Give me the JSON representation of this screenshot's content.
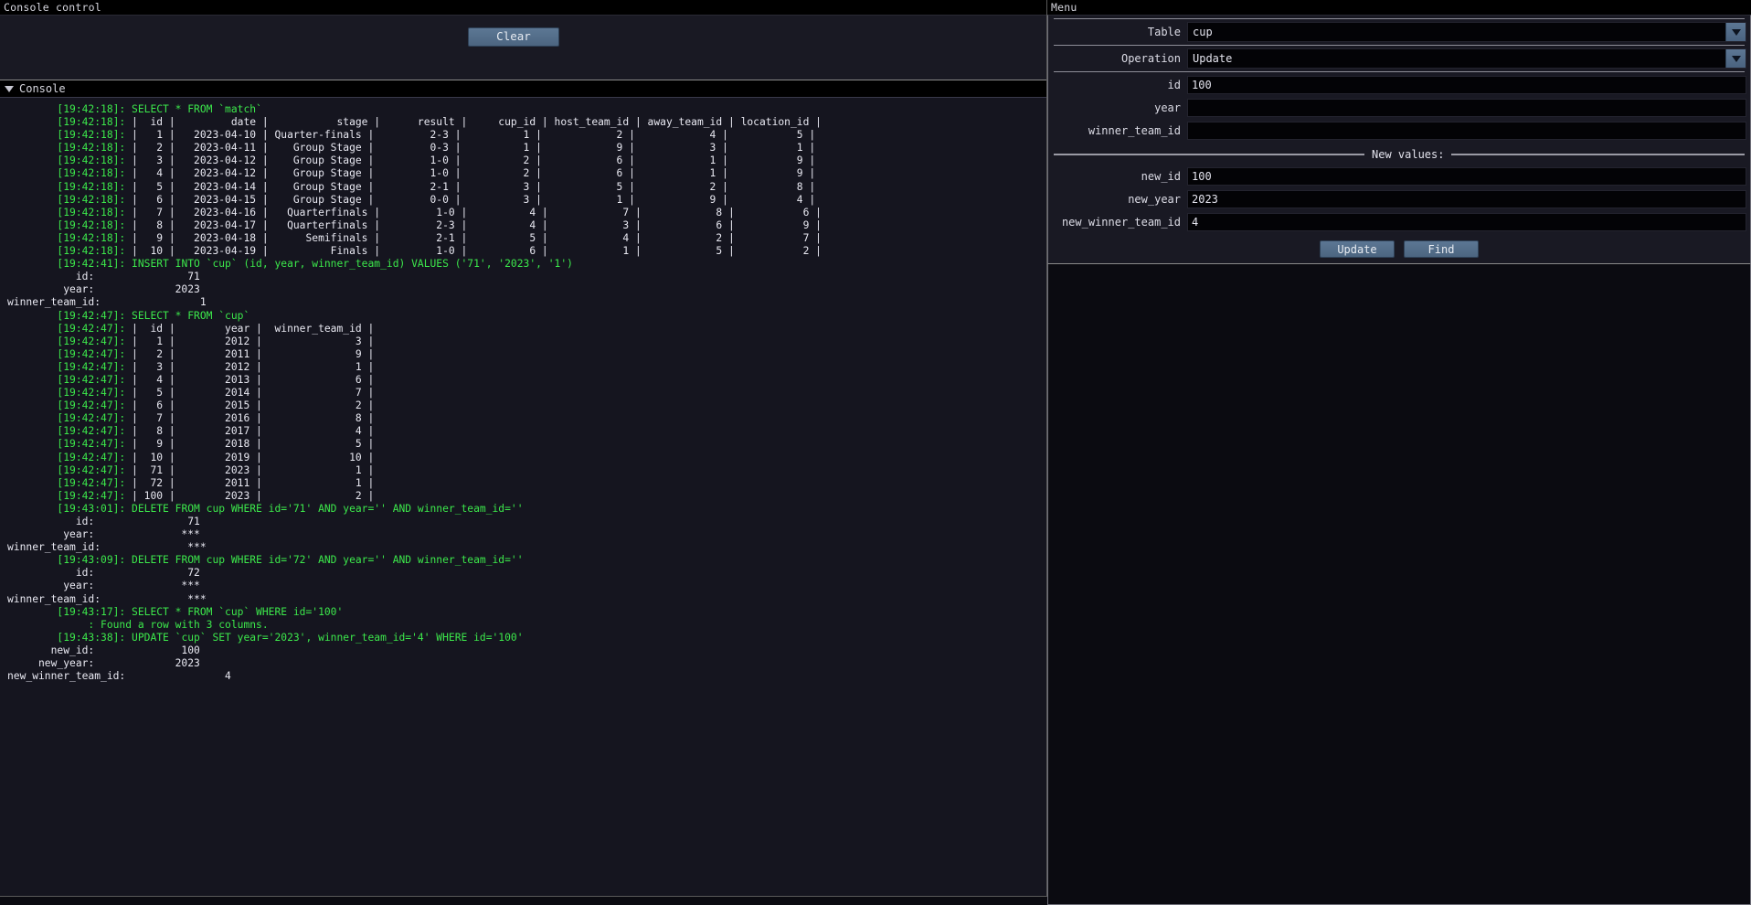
{
  "left_panel": {
    "title": "Console control",
    "toolbar": {
      "clear_label": "Clear"
    },
    "console_section": {
      "header_label": "Console",
      "collapse_icon": "triangle-down-icon"
    }
  },
  "console_log": {
    "lines": [
      {
        "ts": "[19:42:18]:",
        "kind": "query",
        "text": " SELECT * FROM `match`"
      },
      {
        "ts": "[19:42:18]:",
        "kind": "row",
        "text": " |  id |         date |           stage |      result |     cup_id | host_team_id | away_team_id | location_id |"
      },
      {
        "ts": "[19:42:18]:",
        "kind": "row",
        "text": " |   1 |   2023-04-10 | Quarter-finals |         2-3 |          1 |            2 |            4 |           5 |"
      },
      {
        "ts": "[19:42:18]:",
        "kind": "row",
        "text": " |   2 |   2023-04-11 |    Group Stage |         0-3 |          1 |            9 |            3 |           1 |"
      },
      {
        "ts": "[19:42:18]:",
        "kind": "row",
        "text": " |   3 |   2023-04-12 |    Group Stage |         1-0 |          2 |            6 |            1 |           9 |"
      },
      {
        "ts": "[19:42:18]:",
        "kind": "row",
        "text": " |   4 |   2023-04-12 |    Group Stage |         1-0 |          2 |            6 |            1 |           9 |"
      },
      {
        "ts": "[19:42:18]:",
        "kind": "row",
        "text": " |   5 |   2023-04-14 |    Group Stage |         2-1 |          3 |            5 |            2 |           8 |"
      },
      {
        "ts": "[19:42:18]:",
        "kind": "row",
        "text": " |   6 |   2023-04-15 |    Group Stage |         0-0 |          3 |            1 |            9 |           4 |"
      },
      {
        "ts": "[19:42:18]:",
        "kind": "row",
        "text": " |   7 |   2023-04-16 |   Quarterfinals |         1-0 |          4 |            7 |            8 |           6 |"
      },
      {
        "ts": "[19:42:18]:",
        "kind": "row",
        "text": " |   8 |   2023-04-17 |   Quarterfinals |         2-3 |          4 |            3 |            6 |           9 |"
      },
      {
        "ts": "[19:42:18]:",
        "kind": "row",
        "text": " |   9 |   2023-04-18 |      Semifinals |         2-1 |          5 |            4 |            2 |           7 |"
      },
      {
        "ts": "[19:42:18]:",
        "kind": "row",
        "text": " |  10 |   2023-04-19 |          Finals |         1-0 |          6 |            1 |            5 |           2 |"
      },
      {
        "ts": "[19:42:41]:",
        "kind": "query",
        "text": " INSERT INTO `cup` (id, year, winner_team_id) VALUES ('71', '2023', '1')"
      },
      {
        "ts": "",
        "kind": "kv",
        "text": "           id:               71"
      },
      {
        "ts": "",
        "kind": "kv",
        "text": "         year:             2023"
      },
      {
        "ts": "",
        "kind": "kv",
        "text": "winner_team_id:                1"
      },
      {
        "ts": "[19:42:47]:",
        "kind": "query",
        "text": " SELECT * FROM `cup`"
      },
      {
        "ts": "[19:42:47]:",
        "kind": "row",
        "text": " |  id |        year |  winner_team_id |"
      },
      {
        "ts": "[19:42:47]:",
        "kind": "row",
        "text": " |   1 |        2012 |               3 |"
      },
      {
        "ts": "[19:42:47]:",
        "kind": "row",
        "text": " |   2 |        2011 |               9 |"
      },
      {
        "ts": "[19:42:47]:",
        "kind": "row",
        "text": " |   3 |        2012 |               1 |"
      },
      {
        "ts": "[19:42:47]:",
        "kind": "row",
        "text": " |   4 |        2013 |               6 |"
      },
      {
        "ts": "[19:42:47]:",
        "kind": "row",
        "text": " |   5 |        2014 |               7 |"
      },
      {
        "ts": "[19:42:47]:",
        "kind": "row",
        "text": " |   6 |        2015 |               2 |"
      },
      {
        "ts": "[19:42:47]:",
        "kind": "row",
        "text": " |   7 |        2016 |               8 |"
      },
      {
        "ts": "[19:42:47]:",
        "kind": "row",
        "text": " |   8 |        2017 |               4 |"
      },
      {
        "ts": "[19:42:47]:",
        "kind": "row",
        "text": " |   9 |        2018 |               5 |"
      },
      {
        "ts": "[19:42:47]:",
        "kind": "row",
        "text": " |  10 |        2019 |              10 |"
      },
      {
        "ts": "[19:42:47]:",
        "kind": "row",
        "text": " |  71 |        2023 |               1 |"
      },
      {
        "ts": "[19:42:47]:",
        "kind": "row",
        "text": " |  72 |        2011 |               1 |"
      },
      {
        "ts": "[19:42:47]:",
        "kind": "row",
        "text": " | 100 |        2023 |               2 |"
      },
      {
        "ts": "[19:43:01]:",
        "kind": "query",
        "text": " DELETE FROM cup WHERE id='71' AND year='' AND winner_team_id=''"
      },
      {
        "ts": "",
        "kind": "kv",
        "text": "           id:               71"
      },
      {
        "ts": "",
        "kind": "kv",
        "text": "         year:              ***"
      },
      {
        "ts": "",
        "kind": "kv",
        "text": "winner_team_id:              ***"
      },
      {
        "ts": "[19:43:09]:",
        "kind": "query",
        "text": " DELETE FROM cup WHERE id='72' AND year='' AND winner_team_id=''"
      },
      {
        "ts": "",
        "kind": "kv",
        "text": "           id:               72"
      },
      {
        "ts": "",
        "kind": "kv",
        "text": "         year:              ***"
      },
      {
        "ts": "",
        "kind": "kv",
        "text": "winner_team_id:              ***"
      },
      {
        "ts": "[19:43:17]:",
        "kind": "query",
        "text": " SELECT * FROM `cup` WHERE id='100'"
      },
      {
        "ts": "",
        "kind": "note",
        "text": "             : Found a row with 3 columns."
      },
      {
        "ts": "[19:43:38]:",
        "kind": "query",
        "text": " UPDATE `cup` SET year='2023', winner_team_id='4' WHERE id='100'"
      },
      {
        "ts": "",
        "kind": "kv",
        "text": "       new_id:              100"
      },
      {
        "ts": "",
        "kind": "kv",
        "text": "     new_year:             2023"
      },
      {
        "ts": "",
        "kind": "kv",
        "text": "new_winner_team_id:                4"
      }
    ]
  },
  "console_tables": {
    "match": {
      "columns": [
        "id",
        "date",
        "stage",
        "result",
        "cup_id",
        "host_team_id",
        "away_team_id",
        "location_id"
      ],
      "rows": [
        [
          "1",
          "2023-04-10",
          "Quarter-finals",
          "2-3",
          "1",
          "2",
          "4",
          "5"
        ],
        [
          "2",
          "2023-04-11",
          "Group Stage",
          "0-3",
          "1",
          "9",
          "3",
          "1"
        ],
        [
          "3",
          "2023-04-12",
          "Group Stage",
          "1-0",
          "2",
          "6",
          "1",
          "9"
        ],
        [
          "4",
          "2023-04-12",
          "Group Stage",
          "1-0",
          "2",
          "6",
          "1",
          "9"
        ],
        [
          "5",
          "2023-04-14",
          "Group Stage",
          "2-1",
          "3",
          "5",
          "2",
          "8"
        ],
        [
          "6",
          "2023-04-15",
          "Group Stage",
          "0-0",
          "3",
          "1",
          "9",
          "4"
        ],
        [
          "7",
          "2023-04-16",
          "Quarterfinals",
          "1-0",
          "4",
          "7",
          "8",
          "6"
        ],
        [
          "8",
          "2023-04-17",
          "Quarterfinals",
          "2-3",
          "4",
          "3",
          "6",
          "9"
        ],
        [
          "9",
          "2023-04-18",
          "Semifinals",
          "2-1",
          "5",
          "4",
          "2",
          "7"
        ],
        [
          "10",
          "2023-04-19",
          "Finals",
          "1-0",
          "6",
          "1",
          "5",
          "2"
        ]
      ]
    },
    "cup": {
      "columns": [
        "id",
        "year",
        "winner_team_id"
      ],
      "rows": [
        [
          "1",
          "2012",
          "3"
        ],
        [
          "2",
          "2011",
          "9"
        ],
        [
          "3",
          "2012",
          "1"
        ],
        [
          "4",
          "2013",
          "6"
        ],
        [
          "5",
          "2014",
          "7"
        ],
        [
          "6",
          "2015",
          "2"
        ],
        [
          "7",
          "2016",
          "8"
        ],
        [
          "8",
          "2017",
          "4"
        ],
        [
          "9",
          "2018",
          "5"
        ],
        [
          "10",
          "2019",
          "10"
        ],
        [
          "71",
          "2023",
          "1"
        ],
        [
          "72",
          "2011",
          "1"
        ],
        [
          "100",
          "2023",
          "2"
        ]
      ]
    }
  },
  "menu": {
    "title": "Menu",
    "table_label": "Table",
    "table_value": "cup",
    "operation_label": "Operation",
    "operation_value": "Update",
    "fields": [
      {
        "label": "id",
        "value": "100",
        "placeholder": ""
      },
      {
        "label": "year",
        "value": "",
        "placeholder": ""
      },
      {
        "label": "winner_team_id",
        "value": "",
        "placeholder": ""
      }
    ],
    "new_values_label": "New values:",
    "new_fields": [
      {
        "label": "new_id",
        "value": "100",
        "placeholder": ""
      },
      {
        "label": "new_year",
        "value": "2023",
        "placeholder": ""
      },
      {
        "label": "new_winner_team_id",
        "value": "4",
        "placeholder": ""
      }
    ],
    "update_label": "Update",
    "find_label": "Find",
    "dropdown_icon": "chevron-down-icon"
  },
  "colors": {
    "accent_button": "#5c7794",
    "log_query": "#3ce84b",
    "log_text": "#e4e4ec",
    "panel_bg": "#191923",
    "console_bg": "#15151f"
  }
}
